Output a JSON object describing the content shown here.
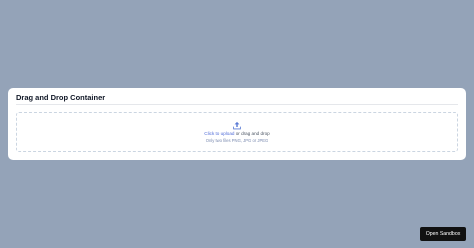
{
  "card": {
    "title": "Drag and Drop Container"
  },
  "dropzone": {
    "icon": "upload-icon",
    "link_text": "Click to upload",
    "rest_text": " or drag and drop",
    "hint": "Only two files PNG, JPG or JPEG"
  },
  "sandbox": {
    "label": "Open Sandbox"
  },
  "colors": {
    "background": "#94a3b8",
    "card": "#ffffff",
    "accent": "#4f6bd8",
    "button": "#111111"
  }
}
